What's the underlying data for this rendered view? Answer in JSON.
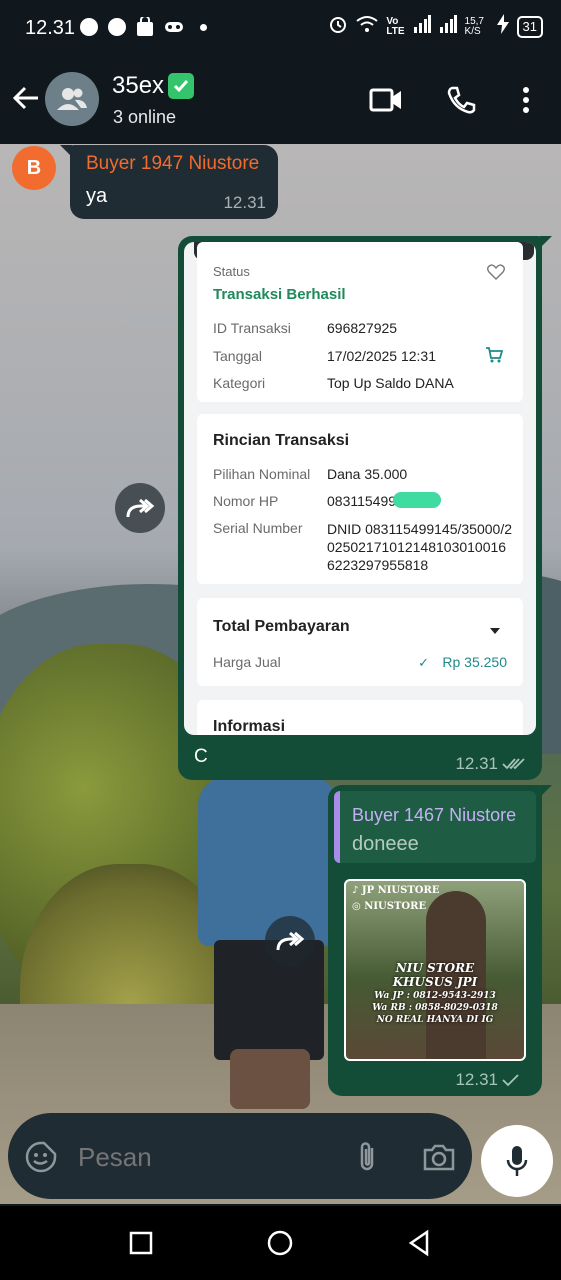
{
  "status_bar": {
    "time": "12.31",
    "network_speed": "15,7 K/S",
    "battery": "31"
  },
  "header": {
    "title": "35ex",
    "subtitle": "3 online"
  },
  "messages": {
    "incoming": {
      "avatar_letter": "B",
      "sender": "Buyer 1947 Niustore",
      "text": "ya",
      "time": "12.31"
    },
    "receipt": {
      "status_label": "Status",
      "status_value": "Transaksi Berhasil",
      "id_label": "ID Transaksi",
      "id_value": "696827925",
      "date_label": "Tanggal",
      "date_value": "17/02/2025 12:31",
      "category_label": "Kategori",
      "category_value": "Top Up Saldo DANA",
      "detail_title": "Rincian Transaksi",
      "nominal_label": "Pilihan Nominal",
      "nominal_value": "Dana 35.000",
      "phone_label": "Nomor HP",
      "phone_value": "083115499145",
      "serial_label": "Serial Number",
      "serial_value": "DNID 083115499145/35000/2025021710121481030100166223297955818",
      "total_title": "Total Pembayaran",
      "price_label": "Harga Jual",
      "price_value": "Rp 35.250",
      "info_title": "Informasi",
      "caption": "C",
      "time": "12.31"
    },
    "outgoing_reply": {
      "quoted_sender": "Buyer 1467 Niustore",
      "quoted_text": "doneee",
      "time": "12.31",
      "sticker": {
        "handle_tiktok": "JP NIUSTORE",
        "handle_ig": "NIUSTORE",
        "title1": "NIU STORE",
        "title2": "KHUSUS JPI",
        "wa_jp": "Wa JP : 0812-9543-2913",
        "wa_rb": "Wa RB : 0858-8029-0318",
        "note": "NO REAL HANYA DI IG"
      }
    }
  },
  "input": {
    "placeholder": "Pesan"
  },
  "colors": {
    "header_bg": "#11181d",
    "incoming_bubble": "#1f2c33",
    "outgoing_bubble": "#144d37",
    "sender_orange": "#f26b2f",
    "success_green": "#1f8a5a",
    "quote_sender_purple": "#c3b1f4"
  }
}
